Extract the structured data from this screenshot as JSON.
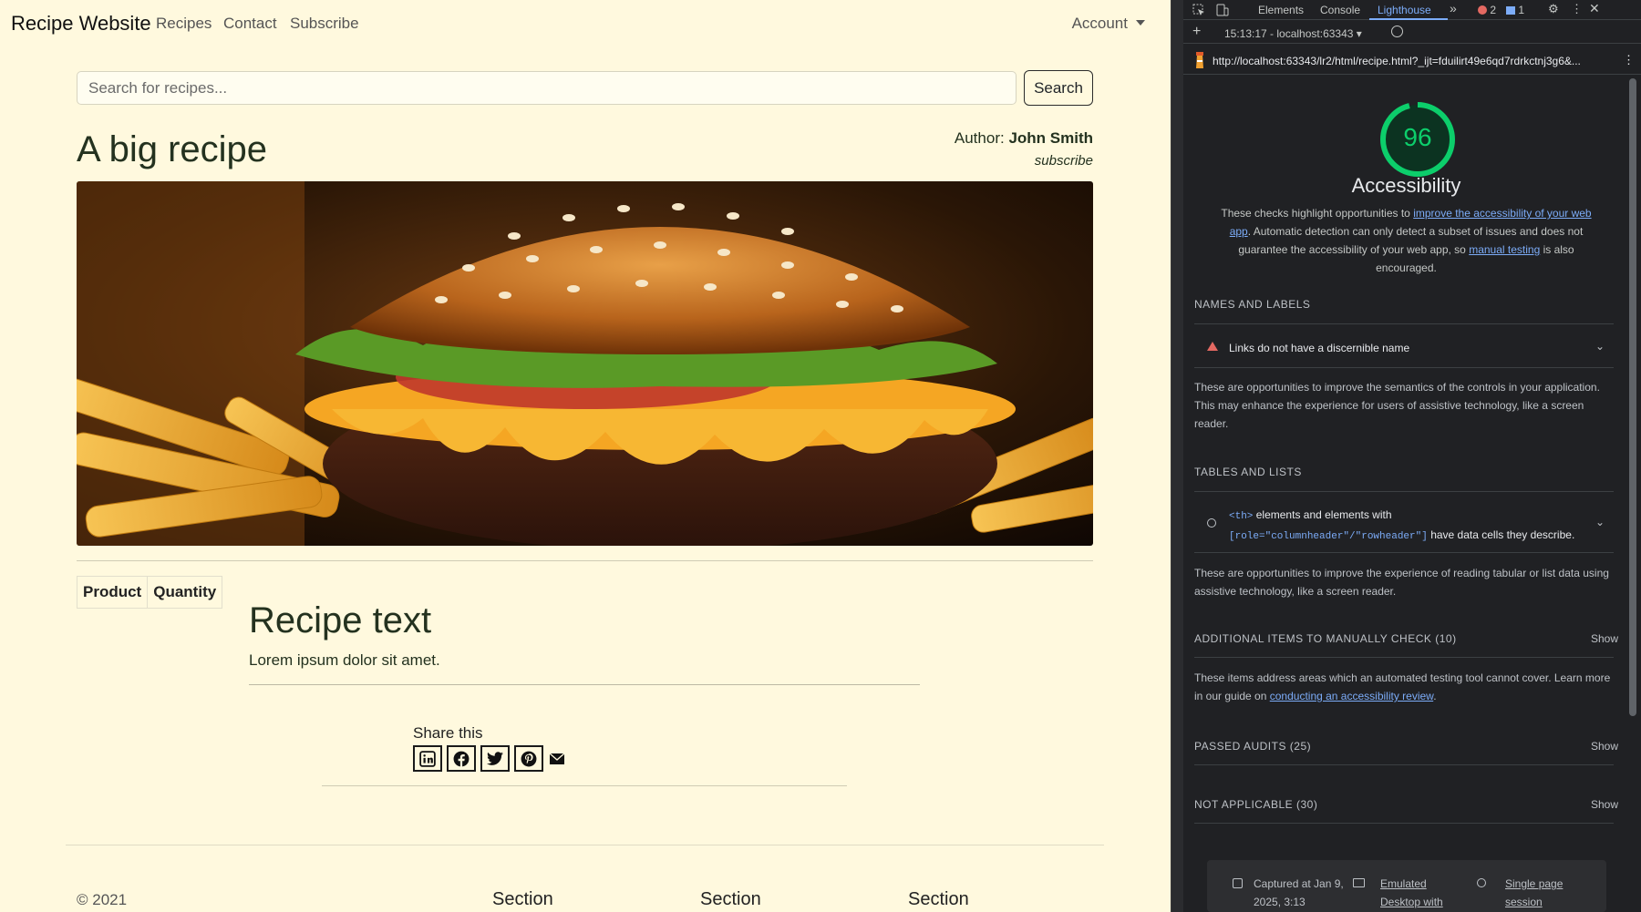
{
  "site": {
    "brand": "Recipe Website",
    "nav": [
      "Recipes",
      "Contact",
      "Subscribe"
    ],
    "account": "Account",
    "search_placeholder": "Search for recipes...",
    "search_button": "Search",
    "title": "A big recipe",
    "author_label": "Author:",
    "author_name": "John Smith",
    "subscribe": "subscribe",
    "table_headers": [
      "Product",
      "Quantity"
    ],
    "recipe_title": "Recipe text",
    "recipe_body": "Lorem ipsum dolor sit amet.",
    "share_label": "Share this",
    "share_icons": [
      "linkedin-icon",
      "facebook-icon",
      "twitter-icon",
      "pinterest-icon",
      "email-icon"
    ],
    "copyright": "© 2021",
    "footer_sections": [
      "Section",
      "Section",
      "Section"
    ]
  },
  "devtools": {
    "tabs": [
      "Elements",
      "Console",
      "Lighthouse"
    ],
    "active_tab": "Lighthouse",
    "error_count": "2",
    "message_count": "1",
    "session": "15:13:17 - localhost:63343",
    "url": "http://localhost:63343/lr2/html/recipe.html?_ijt=fduilirt49e6qd7rdrkctnj3g6&...",
    "score": "96",
    "score_fraction": 0.96,
    "score_color": "#0cce6b",
    "category": "Accessibility",
    "desc_1": "These checks highlight opportunities to",
    "desc_link_1": "improve the accessibility of your web app",
    "desc_2": ". Automatic detection can only detect a subset of issues and does not guarantee the accessibility of your web app, so",
    "desc_link_2": "manual testing",
    "desc_3": "is also encouraged.",
    "names_group": "NAMES AND LABELS",
    "names_audit": "Links do not have a discernible name",
    "names_para": "These are opportunities to improve the semantics of the controls in your application. This may enhance the experience for users of assistive technology, like a screen reader.",
    "tables_group": "TABLES AND LISTS",
    "tables_audit_code_1": "<th>",
    "tables_audit_mid": "elements and elements with",
    "tables_audit_code_2": "[role=\"columnheader\"/\"rowheader\"]",
    "tables_audit_end": "have data cells they describe.",
    "tables_para": "These are opportunities to improve the experience of reading tabular or list data using assistive technology, like a screen reader.",
    "manual_group": "ADDITIONAL ITEMS TO MANUALLY CHECK (10)",
    "manual_para_1": "These items address areas which an automated testing tool cannot cover. Learn more in our guide on",
    "manual_link": "conducting an accessibility review",
    "manual_para_2": ".",
    "passed_group": "PASSED AUDITS (25)",
    "na_group": "NOT APPLICABLE (30)",
    "show": "Show",
    "footer_captured": "Captured at Jan 9, 2025, 3:13",
    "footer_emulated": "Emulated Desktop with",
    "footer_session": "Single page session"
  }
}
